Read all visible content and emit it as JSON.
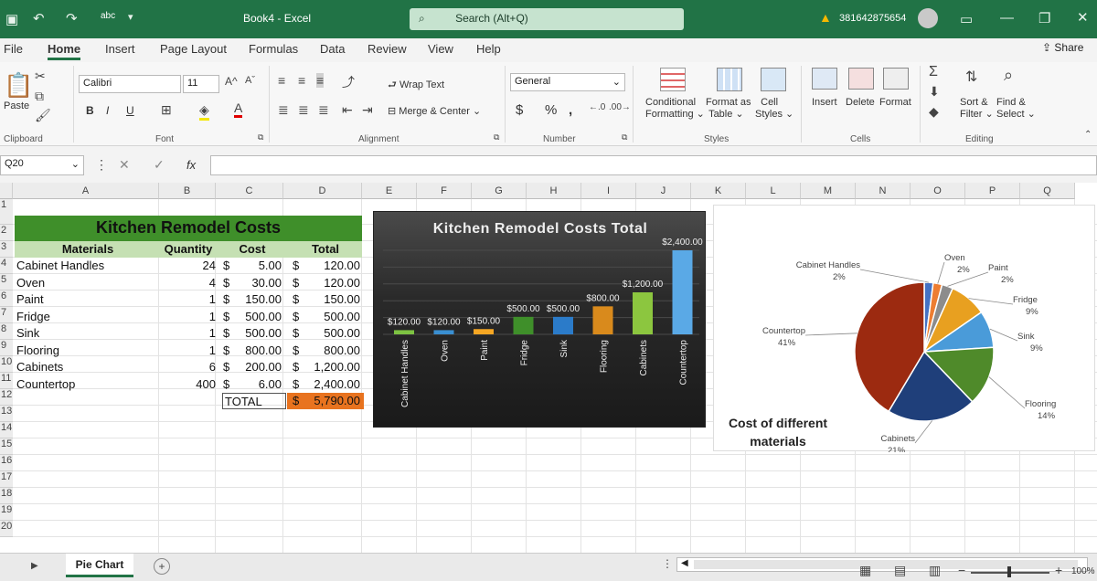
{
  "titlebar": {
    "doc_title": "Book4  -  Excel",
    "search_placeholder": "Search (Alt+Q)",
    "account": "381642875654",
    "qat_abc": "abc"
  },
  "tabs": [
    "File",
    "Home",
    "Insert",
    "Page Layout",
    "Formulas",
    "Data",
    "Review",
    "View",
    "Help"
  ],
  "share_label": "Share",
  "ribbon": {
    "paste": "Paste",
    "font_name": "Calibri",
    "font_size": "11",
    "bold": "B",
    "italic": "I",
    "underline": "U",
    "wrap_text": "Wrap Text",
    "merge_center": "Merge & Center",
    "number_format": "General",
    "currency": "$",
    "percent": "%",
    "comma": "ʔ",
    "conditional": "Conditional",
    "formatting": "Formatting",
    "format_as": "Format as",
    "table": "Table",
    "cell": "Cell",
    "styles_btn": "Styles",
    "insert": "Insert",
    "delete": "Delete",
    "format": "Format",
    "sort": "Sort &",
    "filter": "Filter",
    "find": "Find &",
    "select": "Select",
    "groups": {
      "clipboard": "Clipboard",
      "font": "Font",
      "alignment": "Alignment",
      "number": "Number",
      "styles": "Styles",
      "cells": "Cells",
      "editing": "Editing"
    }
  },
  "formula_bar": {
    "name_box": "Q20",
    "fx": "fx",
    "value": ""
  },
  "columns": [
    "A",
    "B",
    "C",
    "D",
    "E",
    "F",
    "G",
    "H",
    "I",
    "J",
    "K",
    "L",
    "M",
    "N",
    "O",
    "P",
    "Q"
  ],
  "rows": [
    "1",
    "2",
    "3",
    "4",
    "5",
    "6",
    "7",
    "8",
    "9",
    "10",
    "11",
    "12",
    "13",
    "14",
    "15",
    "16",
    "17",
    "18",
    "19",
    "20"
  ],
  "sheet": {
    "title": "Kitchen Remodel Costs",
    "headers": {
      "materials": "Materials",
      "quantity": "Quantity",
      "cost": "Cost",
      "total": "Total"
    },
    "items": [
      {
        "name": "Cabinet Handles",
        "qty": "24",
        "cost": "5.00",
        "total": "120.00"
      },
      {
        "name": "Oven",
        "qty": "4",
        "cost": "30.00",
        "total": "120.00"
      },
      {
        "name": "Paint",
        "qty": "1",
        "cost": "150.00",
        "total": "150.00"
      },
      {
        "name": "Fridge",
        "qty": "1",
        "cost": "500.00",
        "total": "500.00"
      },
      {
        "name": "Sink",
        "qty": "1",
        "cost": "500.00",
        "total": "500.00"
      },
      {
        "name": "Flooring",
        "qty": "1",
        "cost": "800.00",
        "total": "800.00"
      },
      {
        "name": "Cabinets",
        "qty": "6",
        "cost": "200.00",
        "total": "1,200.00"
      },
      {
        "name": "Countertop",
        "qty": "400",
        "cost": "6.00",
        "total": "2,400.00"
      }
    ],
    "currency": "$",
    "total_label": "TOTAL",
    "grand_total": "5,790.00"
  },
  "chart_data": [
    {
      "type": "bar",
      "title": "Kitchen Remodel Costs Total",
      "categories": [
        "Cabinet Handles",
        "Oven",
        "Paint",
        "Fridge",
        "Sink",
        "Flooring",
        "Cabinets",
        "Countertop"
      ],
      "values": [
        120,
        120,
        150,
        500,
        500,
        800,
        1200,
        2400
      ],
      "data_labels": [
        "$120.00",
        "$120.00",
        "$150.00",
        "$500.00",
        "$500.00",
        "$800.00",
        "$1,200.00",
        "$2,400.00"
      ],
      "colors": [
        "#7dc242",
        "#3a8fd1",
        "#f5a623",
        "#3f8f2a",
        "#2b7bc9",
        "#d98a1c",
        "#8cc63f",
        "#5aa9e6"
      ],
      "ylim": [
        0,
        2400
      ]
    },
    {
      "type": "pie",
      "title": "Cost of different materials",
      "categories": [
        "Cabinet Handles",
        "Oven",
        "Paint",
        "Fridge",
        "Sink",
        "Flooring",
        "Cabinets",
        "Countertop"
      ],
      "values": [
        120,
        120,
        150,
        500,
        500,
        800,
        1200,
        2400
      ],
      "percent_labels": [
        "2%",
        "2%",
        "2%",
        "9%",
        "9%",
        "14%",
        "21%",
        "41%"
      ],
      "colors": [
        "#4472c4",
        "#ed7d31",
        "#8c8c8c",
        "#e8a020",
        "#4a9bd9",
        "#4f8a2a",
        "#1f3f7a",
        "#9c2a10"
      ]
    }
  ],
  "sheet_tab": "Pie Chart",
  "zoom": "100%"
}
